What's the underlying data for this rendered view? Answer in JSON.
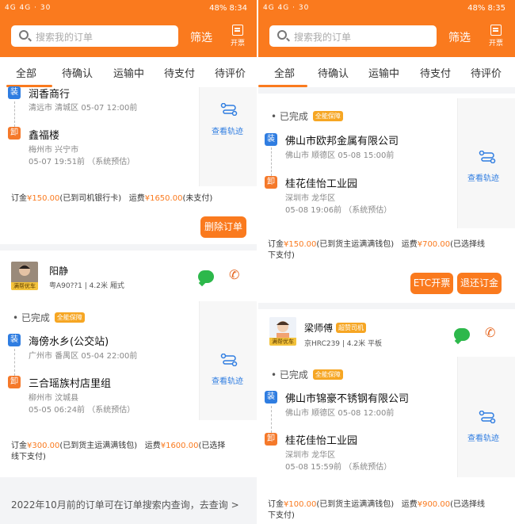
{
  "left": {
    "status_bar": {
      "left": "4G 4G · 30",
      "right": "48% 8:34"
    },
    "search_placeholder": "搜索我的订单",
    "filter_label": "筛选",
    "invoice_label": "开票",
    "tabs": [
      "全部",
      "待确认",
      "运输中",
      "待支付",
      "待评价"
    ],
    "order1": {
      "pickup_name": "润香商行",
      "pickup_addr": "清远市 清城区    05-07 12:00前",
      "drop_name": "鑫福楼",
      "drop_addr1": "梅州市 兴宁市",
      "drop_addr2": "05-07 19:51前  （系统预估）",
      "track": "查看轨迹",
      "deposit_label": "订金",
      "deposit_amount": "¥150.00",
      "deposit_note": "(已到司机银行卡)",
      "freight_label": "运费",
      "freight_amount": "¥1650.00",
      "freight_note": "(未支付)",
      "delete_btn": "删除订单"
    },
    "driver": {
      "name": "阳静",
      "meta": "粤A90??1 | 4.2米 厢式",
      "avatar_label": "满帮优车"
    },
    "order2": {
      "status": "已完成",
      "badge": "全能保障",
      "pickup_name": "海傍水乡(公交站)",
      "pickup_addr": "广州市 番禺区    05-04 22:00前",
      "drop_name": "三合瑶族村店里组",
      "drop_addr1": "柳州市 汶城县",
      "drop_addr2": "05-05 06:24前  （系统预估）",
      "track": "查看轨迹",
      "deposit_label": "订金",
      "deposit_amount": "¥300.00",
      "deposit_note": "(已到货主运满满钱包)",
      "freight_label": "运费",
      "freight_amount": "¥1600.00",
      "freight_note": "(已选择",
      "freight_note2": "线下支付)"
    },
    "footer": "2022年10月前的订单可在订单搜索内查询，去查询 >"
  },
  "right": {
    "status_bar": {
      "left": "4G 4G · 30",
      "right": "48% 8:35"
    },
    "search_placeholder": "搜索我的订单",
    "filter_label": "筛选",
    "invoice_label": "开票",
    "tabs": [
      "全部",
      "待确认",
      "运输中",
      "待支付",
      "待评价"
    ],
    "order1": {
      "status": "已完成",
      "badge": "全能保障",
      "pickup_name": "佛山市欧邦金属有限公司",
      "pickup_addr": "佛山市 顺德区    05-08 15:00前",
      "drop_name": "桂花佳怡工业园",
      "drop_addr1": "深圳市 龙华区",
      "drop_addr2": "05-08 19:06前  （系统预估）",
      "track": "查看轨迹",
      "deposit_label": "订金",
      "deposit_amount": "¥150.00",
      "deposit_note": "(已到货主运满满钱包)",
      "freight_label": "运费",
      "freight_amount": "¥700.00",
      "freight_note": "(已选择线",
      "freight_note2": "下支付)",
      "etc_btn": "ETC开票",
      "refund_btn": "退还订金"
    },
    "driver": {
      "name": "梁师傅",
      "badge": "超赞司机",
      "meta": "京HRC239 | 4.2米 平板",
      "avatar_label": "满帮优车"
    },
    "order2": {
      "status": "已完成",
      "badge": "全能保障",
      "pickup_name": "佛山市锦豪不锈钢有限公司",
      "pickup_addr": "佛山市 顺德区    05-08 12:00前",
      "drop_name": "桂花佳怡工业园",
      "drop_addr1": "深圳市 龙华区",
      "drop_addr2": "05-08 15:59前  （系统预估）",
      "track": "查看轨迹",
      "deposit_label": "订金",
      "deposit_amount": "¥100.00",
      "deposit_note": "(已到货主运满满钱包)",
      "freight_label": "运费",
      "freight_amount": "¥900.00",
      "freight_note": "(已选择线",
      "freight_note2": "下支付)"
    }
  },
  "tags": {
    "pickup": "装",
    "drop": "卸"
  }
}
